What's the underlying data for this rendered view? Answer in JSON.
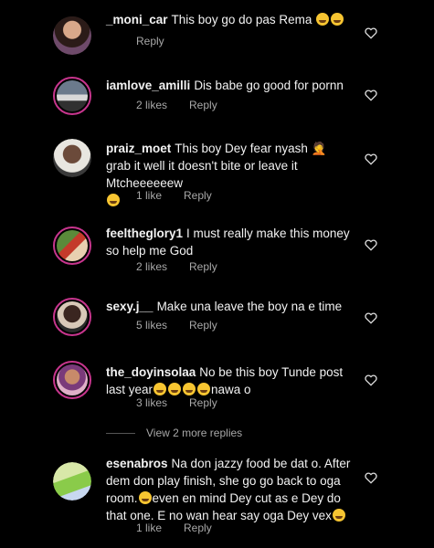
{
  "comments": [
    {
      "user": "_moni_car",
      "text": "This boy go do pas Rema",
      "likes": "",
      "reply": "Reply"
    },
    {
      "user": "iamlove_amilli",
      "text": "Dis babe go good for pornn",
      "likes": "2 likes",
      "reply": "Reply"
    },
    {
      "user": "praiz_moet",
      "text": "This boy Dey fear nyash 🤦 grab it well it doesn't bite or leave it Mtcheeeeeew",
      "likes": "1 like",
      "reply": "Reply"
    },
    {
      "user": "feeltheglory1",
      "text": "I must really make this money so help me God",
      "likes": "2 likes",
      "reply": "Reply"
    },
    {
      "user": "sexy.j__",
      "text": "Make una leave the boy na e time",
      "likes": "5 likes",
      "reply": "Reply"
    },
    {
      "user": "the_doyinsolaa",
      "text": "No be this boy Tunde post last year",
      "tail": "nawa o",
      "likes": "3 likes",
      "reply": "Reply"
    },
    {
      "user": "esenabros",
      "text": "Na don jazzy food be dat o. After dem don play finish, she go go back to oga room.",
      "tail": "even en mind Dey cut as e Dey do that one. E no wan hear say oga Dey vex",
      "likes": "1 like",
      "reply": "Reply"
    }
  ],
  "view_more": "View 2 more replies",
  "colors": {
    "ring": "#c7358d",
    "background": "#000000",
    "meta": "#a8a8a8"
  }
}
